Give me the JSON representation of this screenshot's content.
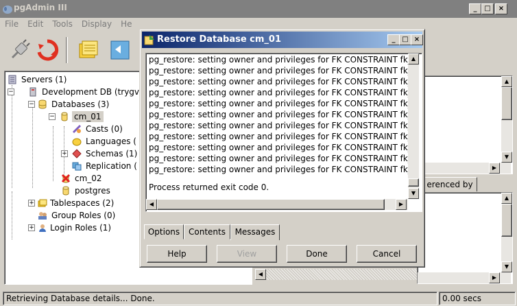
{
  "app": {
    "title": "pgAdmin III",
    "menu": [
      "File",
      "Edit",
      "Tools",
      "Display",
      "He"
    ],
    "caption_buttons": {
      "minimize": "_",
      "maximize": "□",
      "close": "×"
    }
  },
  "tree": {
    "items": [
      {
        "label": "Servers (1)",
        "icon": "servers-icon"
      },
      {
        "label": "Development DB (trygve",
        "icon": "server-icon"
      },
      {
        "label": "Databases (3)",
        "icon": "databases-icon"
      },
      {
        "label": "cm_01",
        "icon": "database-icon"
      },
      {
        "label": "Casts (0)",
        "icon": "casts-icon"
      },
      {
        "label": "Languages (",
        "icon": "languages-icon"
      },
      {
        "label": "Schemas (1)",
        "icon": "schemas-icon"
      },
      {
        "label": "Replication (",
        "icon": "replication-icon"
      },
      {
        "label": "cm_02",
        "icon": "database-error-icon"
      },
      {
        "label": "postgres",
        "icon": "database-icon"
      },
      {
        "label": "Tablespaces (2)",
        "icon": "tablespaces-icon"
      },
      {
        "label": "Group Roles (0)",
        "icon": "group-roles-icon"
      },
      {
        "label": "Login Roles (1)",
        "icon": "login-roles-icon"
      }
    ]
  },
  "right": {
    "tab_label": "erenced by"
  },
  "status": {
    "text": "Retrieving Database details... Done.",
    "time": "0.00 secs"
  },
  "dialog": {
    "title": "Restore Database cm_01",
    "messages": [
      "pg_restore: setting owner and privileges for FK CONSTRAINT fk_",
      "pg_restore: setting owner and privileges for FK CONSTRAINT fk_",
      "pg_restore: setting owner and privileges for FK CONSTRAINT fk_",
      "pg_restore: setting owner and privileges for FK CONSTRAINT fk_",
      "pg_restore: setting owner and privileges for FK CONSTRAINT fk_",
      "pg_restore: setting owner and privileges for FK CONSTRAINT fk_",
      "pg_restore: setting owner and privileges for FK CONSTRAINT fk_",
      "pg_restore: setting owner and privileges for FK CONSTRAINT fk_",
      "pg_restore: setting owner and privileges for FK CONSTRAINT fk_",
      "pg_restore: setting owner and privileges for FK CONSTRAINT fk_",
      "pg_restore: setting owner and privileges for FK CONSTRAINT fk_"
    ],
    "exit_message": "Process returned exit code 0.",
    "tabs": [
      "Options",
      "Contents",
      "Messages"
    ],
    "active_tab": "Messages",
    "buttons": {
      "help": "Help",
      "view": "View",
      "done": "Done",
      "cancel": "Cancel"
    }
  }
}
